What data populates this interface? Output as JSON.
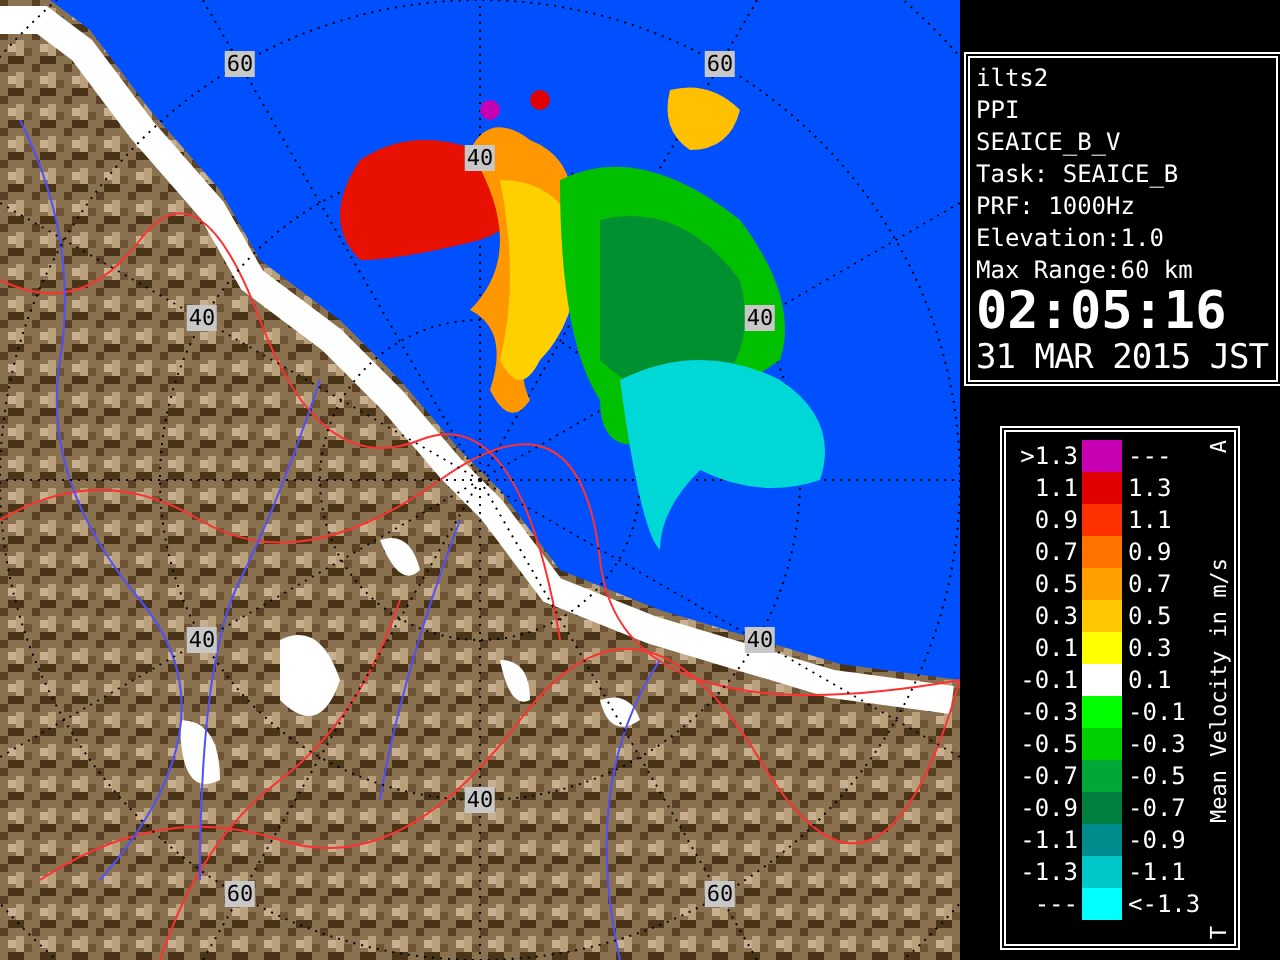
{
  "radar_map": {
    "range_labels": [
      "60",
      "60",
      "40",
      "40",
      "40",
      "40",
      "40",
      "40",
      "60",
      "60"
    ]
  },
  "info_panel": {
    "lines": [
      "ilts2",
      "PPI",
      "SEAICE_B_V",
      "Task: SEAICE_B",
      "PRF: 1000Hz",
      "Elevation:1.0",
      "Max Range:60 km"
    ],
    "time": "02:05:16",
    "date": "31 MAR 2015 JST"
  },
  "legend": {
    "title": "Mean Velocity in m/s",
    "top_mark": "A",
    "bottom_mark": "T",
    "rows": [
      {
        "low": ">1.3",
        "high": "---",
        "color": "#c800b4"
      },
      {
        "low": "1.1",
        "high": "1.3",
        "color": "#e00000"
      },
      {
        "low": "0.9",
        "high": "1.1",
        "color": "#ff3000"
      },
      {
        "low": "0.7",
        "high": "0.9",
        "color": "#ff7400"
      },
      {
        "low": "0.5",
        "high": "0.7",
        "color": "#ffa000"
      },
      {
        "low": "0.3",
        "high": "0.5",
        "color": "#ffc800"
      },
      {
        "low": "0.1",
        "high": "0.3",
        "color": "#ffff00"
      },
      {
        "low": "-0.1",
        "high": "0.1",
        "color": "#ffffff"
      },
      {
        "low": "-0.3",
        "high": "-0.1",
        "color": "#00ff00"
      },
      {
        "low": "-0.5",
        "high": "-0.3",
        "color": "#00d000"
      },
      {
        "low": "-0.7",
        "high": "-0.5",
        "color": "#00a838"
      },
      {
        "low": "-0.9",
        "high": "-0.7",
        "color": "#008040"
      },
      {
        "low": "-1.1",
        "high": "-0.9",
        "color": "#008c8c"
      },
      {
        "low": "-1.3",
        "high": "-1.1",
        "color": "#00c8c8"
      },
      {
        "low": "---",
        "high": "<-1.3",
        "color": "#00ffff"
      }
    ]
  }
}
